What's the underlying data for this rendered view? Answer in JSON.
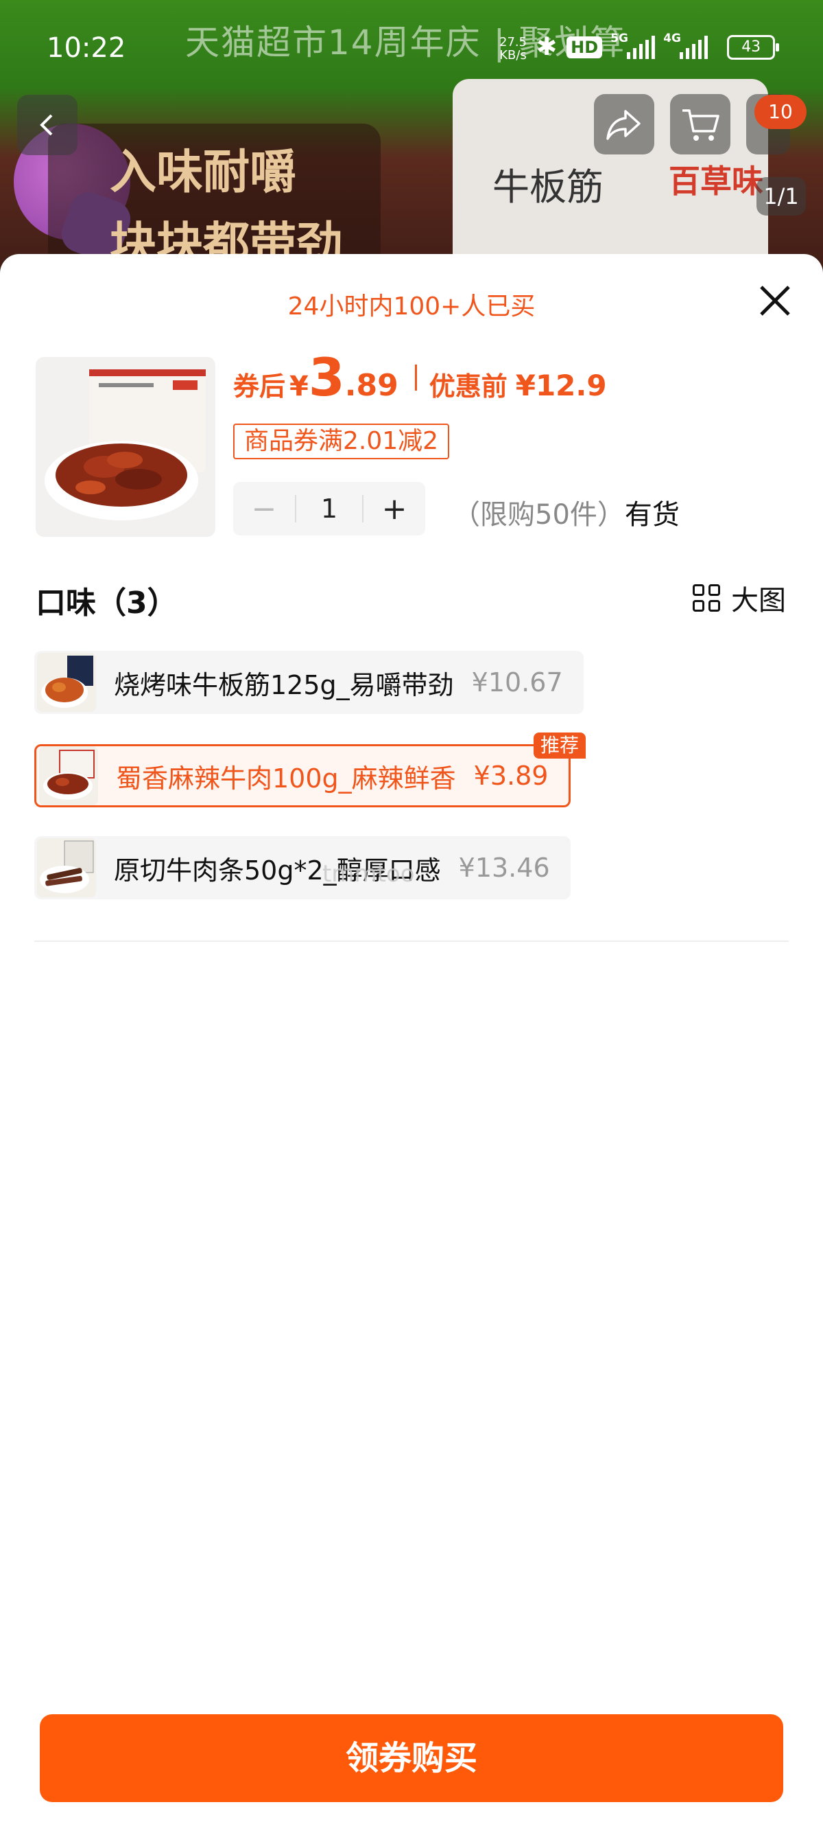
{
  "status_bar": {
    "time": "10:22",
    "net_speed": "27.5",
    "net_unit": "KB/s",
    "hd": "HD",
    "sig1_label": "5G",
    "sig2_label": "4G",
    "battery": "43"
  },
  "background": {
    "banner": "天猫超市14周年庆 | 聚划算",
    "slogan_line1": "入味耐嚼",
    "slogan_line2": "块块都带劲",
    "product_name": "牛板筋",
    "brand": "百草味",
    "cart_count": "10",
    "image_counter": "1/1"
  },
  "sheet": {
    "sales_banner": "24小时内100+人已买",
    "price": {
      "prefix": "券后",
      "currency": "¥",
      "integer": "3",
      "decimal": ".89",
      "original_label": "优惠前",
      "original": "¥12.9"
    },
    "coupon": "商品券满2.01减2",
    "quantity": "1",
    "minus": "−",
    "plus": "+",
    "limit": "（限购50件）",
    "stock": "有货",
    "section_title": "口味（3）",
    "big_view": "大图",
    "options": [
      {
        "name": "烧烤味牛板筋125g_易嚼带劲",
        "price": "¥10.67",
        "selected": false
      },
      {
        "name": "蜀香麻辣牛肉100g_麻辣鲜香",
        "price": "¥3.89",
        "selected": true
      },
      {
        "name": "原切牛肉条50g*2_醇厚口感",
        "price": "¥13.46",
        "selected": false
      }
    ],
    "recommend_badge": "推荐",
    "watermark": "tmmtoo",
    "buy_button": "领券购买"
  },
  "colors": {
    "accent": "#f0561c",
    "buy_button": "#ff5a0a"
  }
}
